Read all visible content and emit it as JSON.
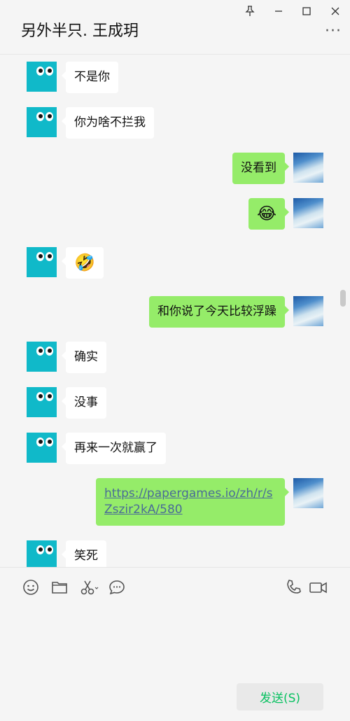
{
  "header": {
    "title": "另外半只. 王成玥",
    "pin_icon": "pin-icon",
    "minimize_icon": "minimize-icon",
    "maximize_icon": "maximize-icon",
    "close_icon": "close-icon",
    "more_icon": "more-icon"
  },
  "messages": [
    {
      "side": "left",
      "text": "不是你"
    },
    {
      "side": "left",
      "text": "你为啥不拦我"
    },
    {
      "side": "right",
      "text": "没看到"
    },
    {
      "side": "right",
      "text": "😂"
    },
    {
      "side": "left",
      "text": "🤣"
    },
    {
      "side": "right",
      "text": "和你说了今天比较浮躁"
    },
    {
      "side": "left",
      "text": "确实"
    },
    {
      "side": "left",
      "text": "没事"
    },
    {
      "side": "left",
      "text": "再来一次就赢了"
    },
    {
      "side": "right",
      "text": "https://papergames.io/zh/r/sZszir2kA/580"
    },
    {
      "side": "left",
      "text": "笑死"
    }
  ],
  "toolbar": {
    "icons": [
      "emoji-icon",
      "folder-icon",
      "scissors-icon",
      "chat-bubble-icon",
      "phone-icon",
      "video-call-icon"
    ],
    "send_label": "发送(S)"
  },
  "colors": {
    "background": "#f5f5f5",
    "bubble_self": "#95ec69",
    "bubble_other": "#ffffff",
    "avatar_other": "#10b9c9",
    "send_text": "#07c160",
    "link": "#4a6b97"
  }
}
